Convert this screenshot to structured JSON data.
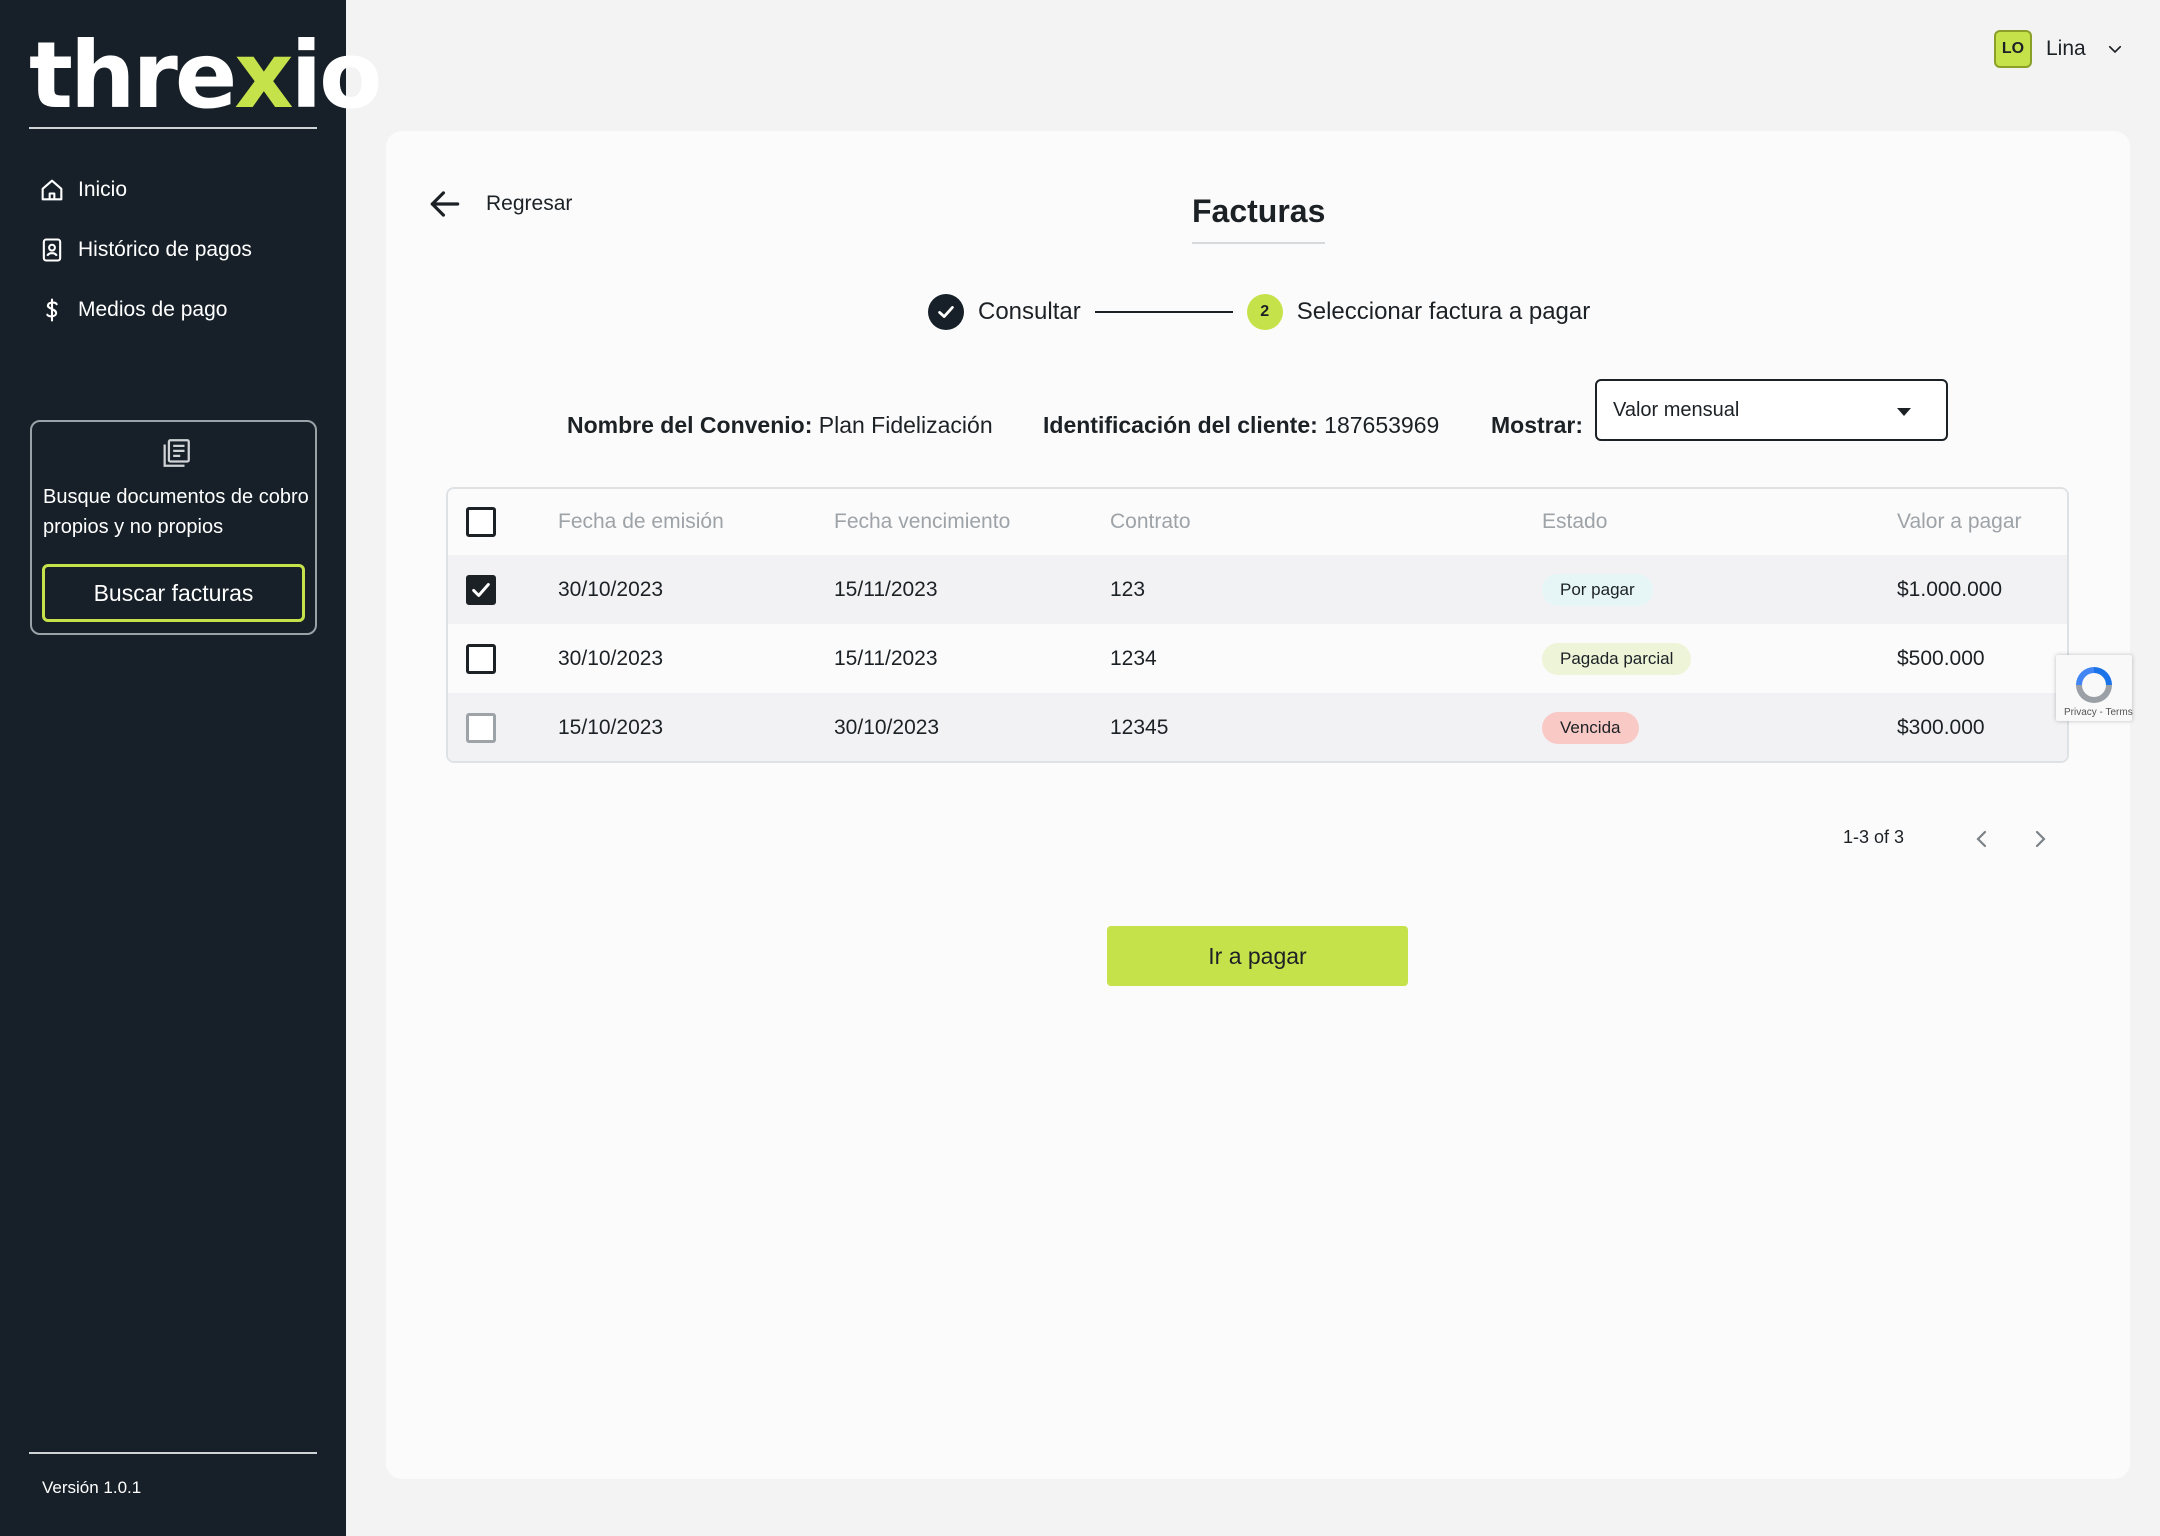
{
  "brand": {
    "logo_pre": "thre",
    "logo_x": "x",
    "logo_post": "io",
    "accent": "#c6e24a",
    "sidebar_bg": "#172028"
  },
  "sidebar": {
    "items": [
      {
        "label": "Inicio",
        "icon": "home-icon"
      },
      {
        "label": "Histórico de pagos",
        "icon": "contact-book-icon"
      },
      {
        "label": "Medios de pago",
        "icon": "dollar-icon"
      }
    ],
    "card": {
      "icon": "documents-icon",
      "text": "Busque documentos de cobro propios y no propios",
      "button": "Buscar facturas"
    },
    "version": "Versión 1.0.1"
  },
  "user": {
    "initials": "LO",
    "name": "Lina"
  },
  "page": {
    "back_label": "Regresar",
    "title": "Facturas",
    "steps": [
      {
        "label": "Consultar",
        "state": "done"
      },
      {
        "number": "2",
        "label": "Seleccionar factura a pagar",
        "state": "active"
      }
    ],
    "info": {
      "convenio_label": "Nombre del Convenio:",
      "convenio_value": "Plan Fidelización",
      "cliente_label": "Identificación del cliente:",
      "cliente_value": "187653969",
      "mostrar_label": "Mostrar:",
      "mostrar_value": "Valor mensual"
    },
    "table": {
      "columns": [
        "Fecha de emisión",
        "Fecha vencimiento",
        "Contrato",
        "Estado",
        "Valor a pagar"
      ],
      "rows": [
        {
          "checked": true,
          "emision": "30/10/2023",
          "vencimiento": "15/11/2023",
          "contrato": "123",
          "estado": "Por pagar",
          "valor": "$1.000.000"
        },
        {
          "checked": false,
          "emision": "30/10/2023",
          "vencimiento": "15/11/2023",
          "contrato": "1234",
          "estado": "Pagada parcial",
          "valor": "$500.000"
        },
        {
          "checked": false,
          "disabled": true,
          "emision": "15/10/2023",
          "vencimiento": "30/10/2023",
          "contrato": "12345",
          "estado": "Vencida",
          "valor": "$300.000"
        }
      ]
    },
    "pagination": {
      "text": "1-3 of 3"
    },
    "pay_button": "Ir a pagar",
    "recaptcha": "Privacy - Terms"
  }
}
